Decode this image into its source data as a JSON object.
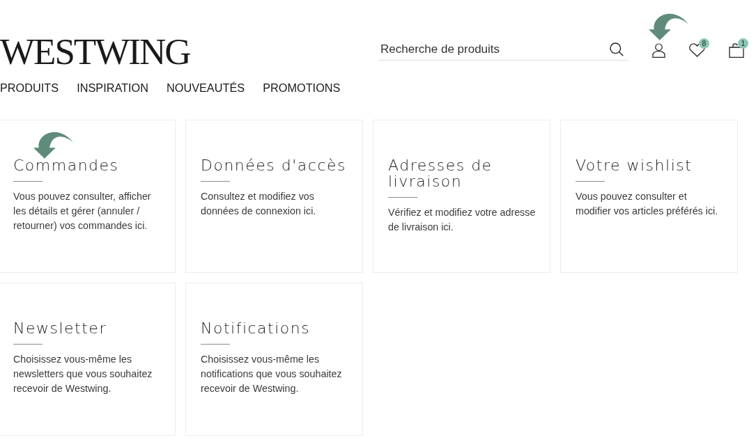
{
  "header": {
    "logo": "WESTWING",
    "search": {
      "placeholder": "Recherche de produits"
    },
    "actions": [
      {
        "kind": "account",
        "pointed": true
      },
      {
        "kind": "wishlist",
        "badge": "8",
        "pointed": false
      },
      {
        "kind": "cart",
        "badge": "1",
        "pointed": false
      }
    ]
  },
  "nav": {
    "items": [
      "PRODUITS",
      "INSPIRATION",
      "NOUVEAUTÉS",
      "PROMOTIONS"
    ]
  },
  "cards": [
    {
      "title": "Commandes",
      "description": "Vous pouvez consulter, afficher les détails et gérer (annuler / retourner) vos commandes ici.",
      "pointed": true
    },
    {
      "title": "Données d'accès",
      "description": "Consultez et modifiez vos données de connexion ici.",
      "pointed": false
    },
    {
      "title": "Adresses de livraison",
      "description": "Vérifiez et modifiez votre adresse de livraison ici.",
      "pointed": false
    },
    {
      "title": "Votre wishlist",
      "description": "Vous pouvez consulter et modifier vos articles préférés ici.",
      "pointed": false
    },
    {
      "title": "Newsletter",
      "description": "Choisissez vous-même les newsletters que vous souhaitez recevoir de Westwing.",
      "pointed": false
    },
    {
      "title": "Notifications",
      "description": "Choisissez vous-même les notifications que vous souhaitez recevoir de Westwing.",
      "pointed": false
    }
  ]
}
